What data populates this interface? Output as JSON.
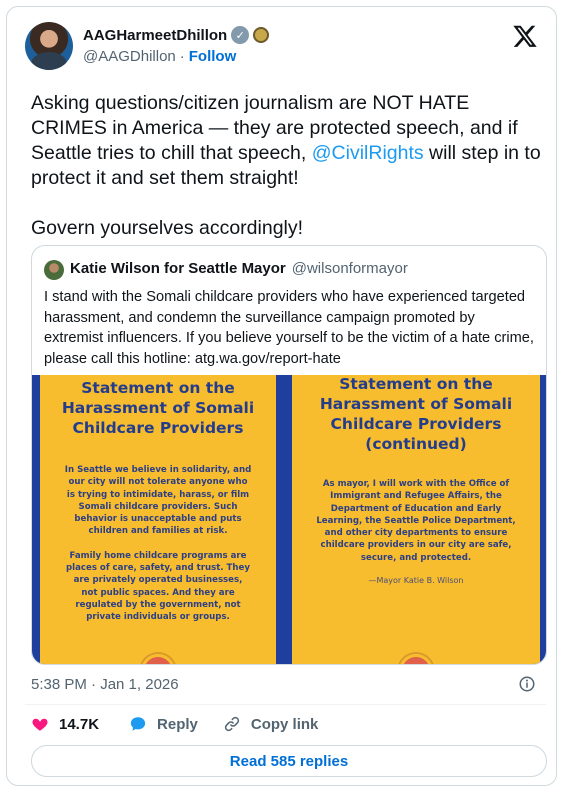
{
  "author": {
    "name": "AAGHarmeetDhillon",
    "handle": "@AAGDhillon",
    "separator": "·",
    "follow_label": "Follow"
  },
  "tweet": {
    "text_before": "Asking questions/citizen journalism are NOT HATE CRIMES in America — they are protected speech, and if Seattle tries to chill that speech, ",
    "mention": "@CivilRights",
    "text_after": " will step in to protect it and set them straight!\n\nGovern yourselves accordingly!"
  },
  "quote": {
    "name": "Katie Wilson for Seattle Mayor",
    "handle": "@wilsonformayor",
    "text": "I stand with the Somali childcare providers who have experienced targeted harassment, and condemn the surveillance campaign promoted by extremist influencers. If you believe yourself to be the victim of a hate crime, please call this hotline: atg.wa.gov/report-hate",
    "images": [
      {
        "title": "Statement on the\nHarassment of Somali\nChildcare Providers",
        "paragraph1": "In Seattle we believe in solidarity, and\nour city will not tolerate anyone who\nis trying to intimidate, harass, or film\nSomali childcare providers. Such\nbehavior is unacceptable and puts\nchildren and families at risk.",
        "paragraph2": "Family home childcare programs are\nplaces of care, safety, and trust. They\nare privately operated businesses,\nnot public spaces. And they are\nregulated by the government, not\nprivate individuals or groups."
      },
      {
        "title": "Statement on the\nHarassment of Somali\nChildcare Providers\n(continued)",
        "paragraph1": "As mayor, I will work with the Office of\nImmigrant and Refugee Affairs, the\nDepartment of Education and Early\nLearning, the Seattle Police Department,\nand other city departments to ensure\nchildcare providers in our city are safe,\nsecure, and protected.",
        "signature": "—Mayor Katie B. Wilson"
      }
    ]
  },
  "meta": {
    "timestamp": "5:38 PM · Jan 1, 2026"
  },
  "actions": {
    "likes": "14.7K",
    "reply_label": "Reply",
    "copy_link_label": "Copy link",
    "read_replies_label": "Read 585 replies"
  },
  "colors": {
    "accent": "#1d9bf0",
    "like": "#f91880",
    "poster_background": "#f7bd2e",
    "poster_text": "#243c8c"
  }
}
